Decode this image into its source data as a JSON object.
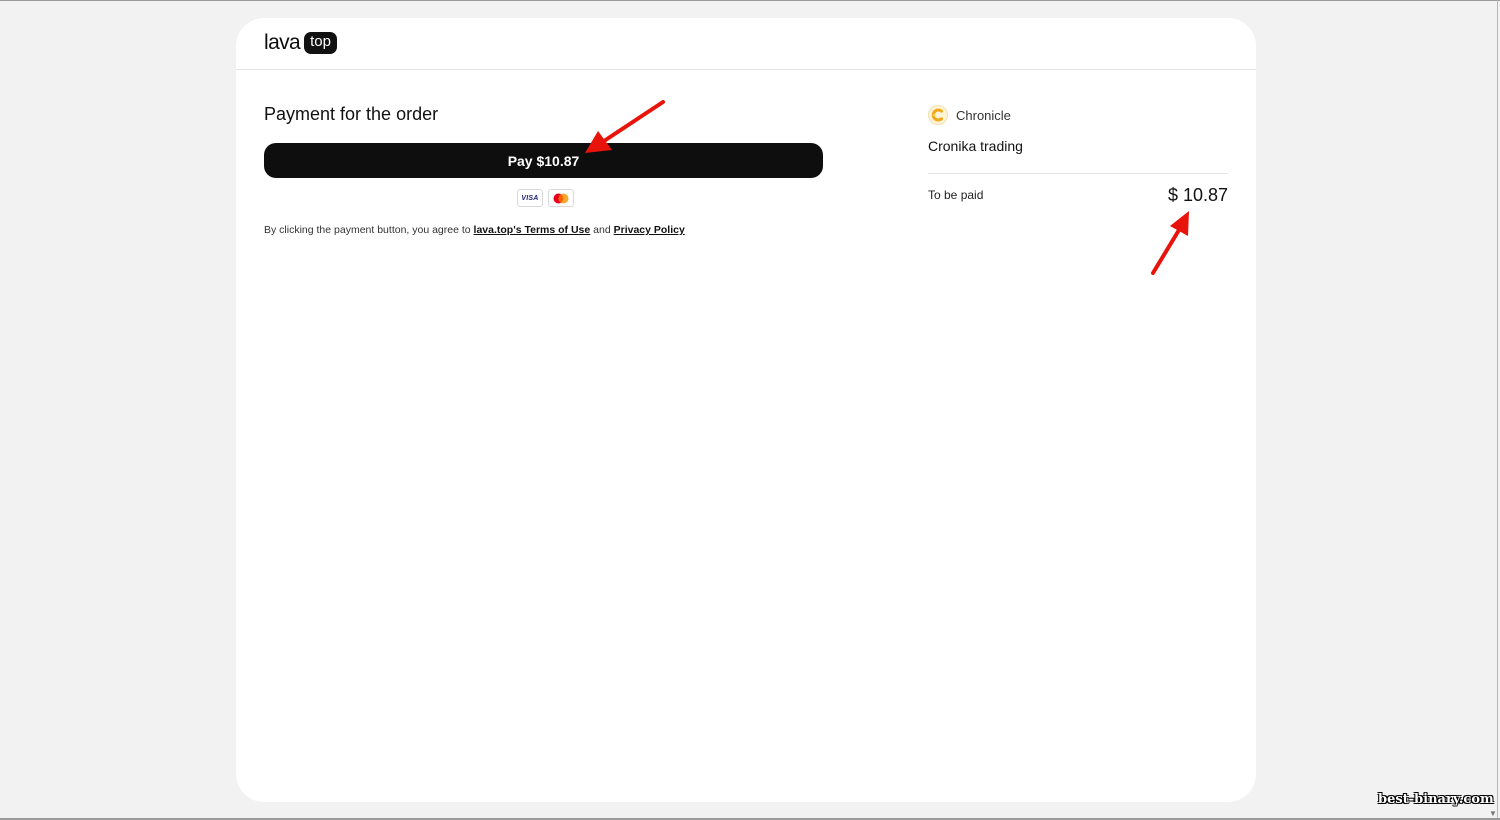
{
  "header": {
    "logo_word": "lava",
    "logo_badge": "top"
  },
  "payment": {
    "title": "Payment for the order",
    "pay_button_label": "Pay $10.87",
    "card_icons": [
      "visa-icon",
      "mastercard-icon"
    ],
    "visa_label": "VISA",
    "terms_prefix": "By clicking the payment button, you agree to",
    "terms_link": "lava.top's Terms of Use",
    "terms_and": "and",
    "privacy_link": "Privacy Policy"
  },
  "summary": {
    "merchant_name": "Chronicle",
    "product_name": "Cronika trading",
    "to_be_paid_label": "To be paid",
    "amount": "$ 10.87"
  },
  "watermark": "best-binary.com",
  "colors": {
    "page_bg": "#f2f2f2",
    "card_bg": "#ffffff",
    "button_bg": "#0e0e0e",
    "arrow": "#e8140c"
  }
}
